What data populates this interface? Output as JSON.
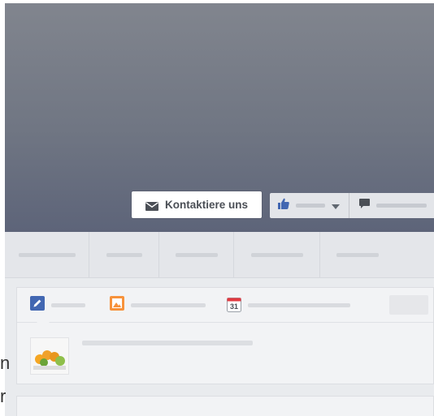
{
  "cover": {
    "contact_button": {
      "label": "Kontaktiere uns",
      "icon": "envelope-icon"
    },
    "like_button": {
      "icon": "thumbs-up-icon",
      "dropdown_icon": "caret-down-icon"
    },
    "message_button": {
      "icon": "speech-bubble-icon"
    }
  },
  "composer": {
    "tabs": [
      {
        "icon": "pencil-icon"
      },
      {
        "icon": "photo-icon"
      },
      {
        "icon": "calendar-icon",
        "icon_text": "31"
      }
    ]
  },
  "edge_text": {
    "line1": "n",
    "line2": "r"
  },
  "colors": {
    "cover_top": "#81858e",
    "cover_bottom": "#5d6479",
    "accent_blue": "#4267b2",
    "calendar_red": "#e2383f"
  }
}
